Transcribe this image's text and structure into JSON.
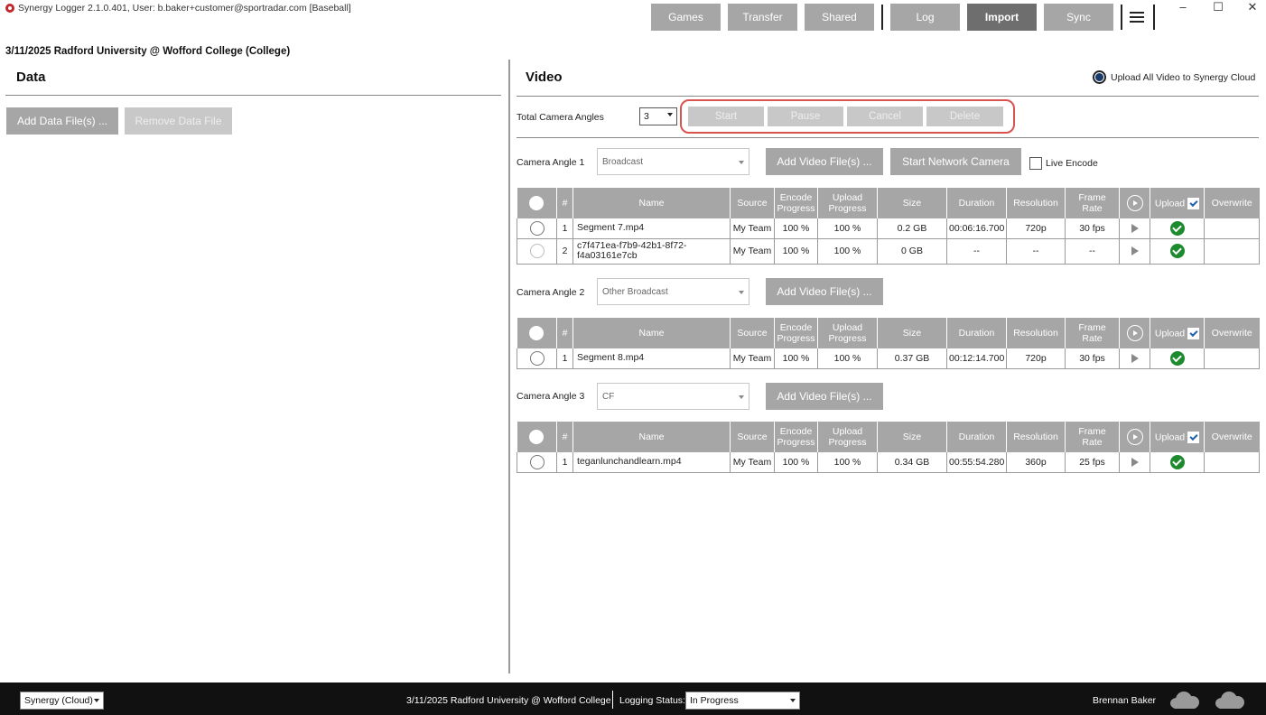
{
  "window": {
    "title": "Synergy Logger 2.1.0.401, User: b.baker+customer@sportradar.com [Baseball]",
    "minimize": "–",
    "maximize": "☐",
    "close": "✕"
  },
  "nav": {
    "games": "Games",
    "transfer": "Transfer",
    "shared": "Shared",
    "log": "Log",
    "import": "Import",
    "sync": "Sync"
  },
  "game_heading": "3/11/2025 Radford University @ Wofford College (College)",
  "data_panel": {
    "title": "Data",
    "add_button": "Add Data File(s) ...",
    "remove_button": "Remove Data File"
  },
  "video_panel": {
    "title": "Video",
    "upload_all_label": "Upload All Video to Synergy Cloud",
    "total_angles_label": "Total Camera Angles",
    "total_angles_value": "3",
    "controls": {
      "start": "Start",
      "pause": "Pause",
      "cancel": "Cancel",
      "delete": "Delete"
    },
    "add_video_label": "Add Video File(s) ...",
    "start_network_camera": "Start Network Camera",
    "live_encode": "Live Encode",
    "columns": {
      "num": "#",
      "name": "Name",
      "source": "Source",
      "encode": "Encode Progress",
      "upload_progress": "Upload Progress",
      "size": "Size",
      "duration": "Duration",
      "resolution": "Resolution",
      "frame_rate": "Frame Rate",
      "upload": "Upload",
      "overwrite": "Overwrite"
    },
    "angles": [
      {
        "label": "Camera Angle 1",
        "select": "Broadcast",
        "rows": [
          {
            "num": "1",
            "name": "Segment 7.mp4",
            "source": "My Team",
            "encode": "100 %",
            "upload": "100 %",
            "size": "0.2 GB",
            "duration": "00:06:16.700",
            "resolution": "720p",
            "frame_rate": "30 fps"
          },
          {
            "num": "2",
            "name": "c7f471ea-f7b9-42b1-8f72-f4a03161e7cb",
            "source": "My Team",
            "encode": "100 %",
            "upload": "100 %",
            "size": "0 GB",
            "duration": "--",
            "resolution": "--",
            "frame_rate": "--"
          }
        ]
      },
      {
        "label": "Camera Angle 2",
        "select": "Other Broadcast",
        "rows": [
          {
            "num": "1",
            "name": "Segment 8.mp4",
            "source": "My Team",
            "encode": "100 %",
            "upload": "100 %",
            "size": "0.37 GB",
            "duration": "00:12:14.700",
            "resolution": "720p",
            "frame_rate": "30 fps"
          }
        ]
      },
      {
        "label": "Camera Angle 3",
        "select": "CF",
        "rows": [
          {
            "num": "1",
            "name": "teganlunchandlearn.mp4",
            "source": "My Team",
            "encode": "100 %",
            "upload": "100 %",
            "size": "0.34 GB",
            "duration": "00:55:54.280",
            "resolution": "360p",
            "frame_rate": "25 fps"
          }
        ]
      }
    ]
  },
  "footer": {
    "server": "Synergy (Cloud)",
    "game": "3/11/2025 Radford University @ Wofford College",
    "logging_status_label": "Logging Status:",
    "logging_status_value": "In Progress",
    "user": "Brennan  Baker"
  },
  "colors": {
    "button_gray": "#a6a6a6",
    "active_nav": "#6e6e6e",
    "highlight": "#d9534f",
    "upload_check": "#1d8a2e",
    "footer_bg": "#111111"
  }
}
